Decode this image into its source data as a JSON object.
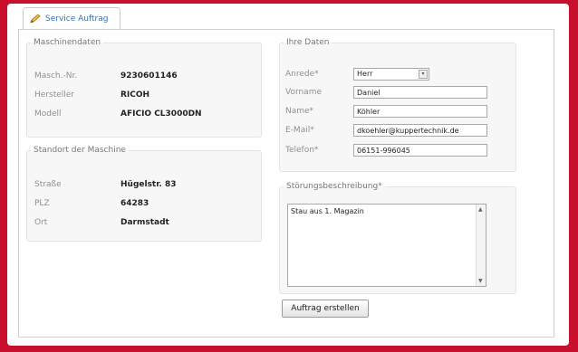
{
  "tab": {
    "label": "Service Auftrag",
    "icon": "pencil-icon"
  },
  "machine": {
    "legend": "Maschinendaten",
    "rows": [
      {
        "label": "Masch.-Nr.",
        "value": "9230601146"
      },
      {
        "label": "Hersteller",
        "value": "RICOH"
      },
      {
        "label": "Modell",
        "value": "AFICIO CL3000DN"
      }
    ]
  },
  "location": {
    "legend": "Standort der Maschine",
    "rows": [
      {
        "label": "Straße",
        "value": "Hügelstr. 83"
      },
      {
        "label": "PLZ",
        "value": "64283"
      },
      {
        "label": "Ort",
        "value": "Darmstadt"
      }
    ]
  },
  "contact": {
    "legend": "Ihre Daten",
    "anrede": {
      "label": "Anrede*",
      "value": "Herr"
    },
    "vorname": {
      "label": "Vorname",
      "value": "Daniel"
    },
    "name": {
      "label": "Name*",
      "value": "Köhler"
    },
    "email": {
      "label": "E-Mail*",
      "value": "dkoehler@kuppertechnik.de"
    },
    "telefon": {
      "label": "Telefon*",
      "value": "06151-996045"
    }
  },
  "fault": {
    "legend": "Störungsbeschreibung*",
    "text": "Stau aus 1. Magazin"
  },
  "submit": {
    "label": "Auftrag erstellen"
  }
}
